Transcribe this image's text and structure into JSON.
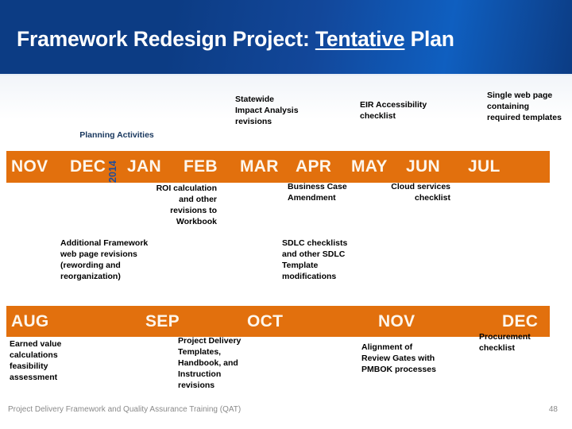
{
  "header": {
    "title_pre": "Framework Redesign Project: ",
    "title_underlined": "Tentative",
    "title_post": " Plan"
  },
  "section_labels": {
    "planning_activities": "Planning Activities"
  },
  "year_tag": "2014",
  "timeline_top": {
    "months": [
      "NOV",
      "DEC",
      "JAN",
      "FEB",
      "MAR",
      "APR",
      "MAY",
      "JUN",
      "JUL"
    ]
  },
  "timeline_bottom": {
    "months": [
      "AUG",
      "SEP",
      "OCT",
      "NOV",
      "DEC"
    ]
  },
  "notes_above_top_bar": [
    {
      "text": "Statewide Impact Analysis revisions"
    },
    {
      "text": "EIR Accessibility checklist"
    },
    {
      "text": "Single web page containing required templates"
    }
  ],
  "notes_below_top_bar": [
    {
      "text": "Additional Framework web page revisions (rewording and reorganization)"
    },
    {
      "text": "ROI calculation and other revisions to Workbook"
    },
    {
      "text": "Business Case Amendment"
    },
    {
      "text": "SDLC checklists and other SDLC Template modifications"
    },
    {
      "text": "Cloud services checklist"
    }
  ],
  "notes_below_bottom_bar": [
    {
      "text": "Earned value calculations feasibility assessment"
    },
    {
      "text": "Project Delivery Templates, Handbook, and Instruction revisions"
    },
    {
      "text": "Alignment of Review Gates with PMBOK processes"
    },
    {
      "text": "Procurement checklist"
    }
  ],
  "footer": {
    "text": "Project Delivery Framework and Quality Assurance Training (QAT)",
    "page_number": "48"
  },
  "colors": {
    "header_blue": "#0c3c84",
    "timeline_orange": "#e2700d",
    "label_navy": "#17365d",
    "year_blue": "#1f4e9c",
    "footer_gray": "#8a8a8a"
  }
}
